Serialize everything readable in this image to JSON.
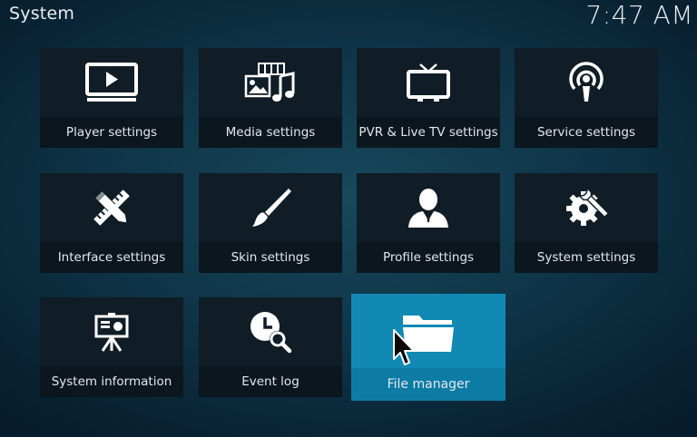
{
  "header": {
    "title": "System",
    "time": "7:47 AM"
  },
  "tiles": [
    {
      "label": "Player settings",
      "icon": "player-icon"
    },
    {
      "label": "Media settings",
      "icon": "media-icon"
    },
    {
      "label": "PVR & Live TV settings",
      "icon": "tv-icon"
    },
    {
      "label": "Service settings",
      "icon": "service-icon"
    },
    {
      "label": "Interface settings",
      "icon": "interface-icon"
    },
    {
      "label": "Skin settings",
      "icon": "brush-icon"
    },
    {
      "label": "Profile settings",
      "icon": "profile-icon"
    },
    {
      "label": "System settings",
      "icon": "gear-wrench-icon"
    },
    {
      "label": "System information",
      "icon": "presentation-icon"
    },
    {
      "label": "Event log",
      "icon": "clock-search-icon"
    },
    {
      "label": "File manager",
      "icon": "folder-icon",
      "focused": true
    }
  ],
  "colors": {
    "background": "#0f3447",
    "tile": "#101d26",
    "focused_tile": "#1289b4"
  }
}
